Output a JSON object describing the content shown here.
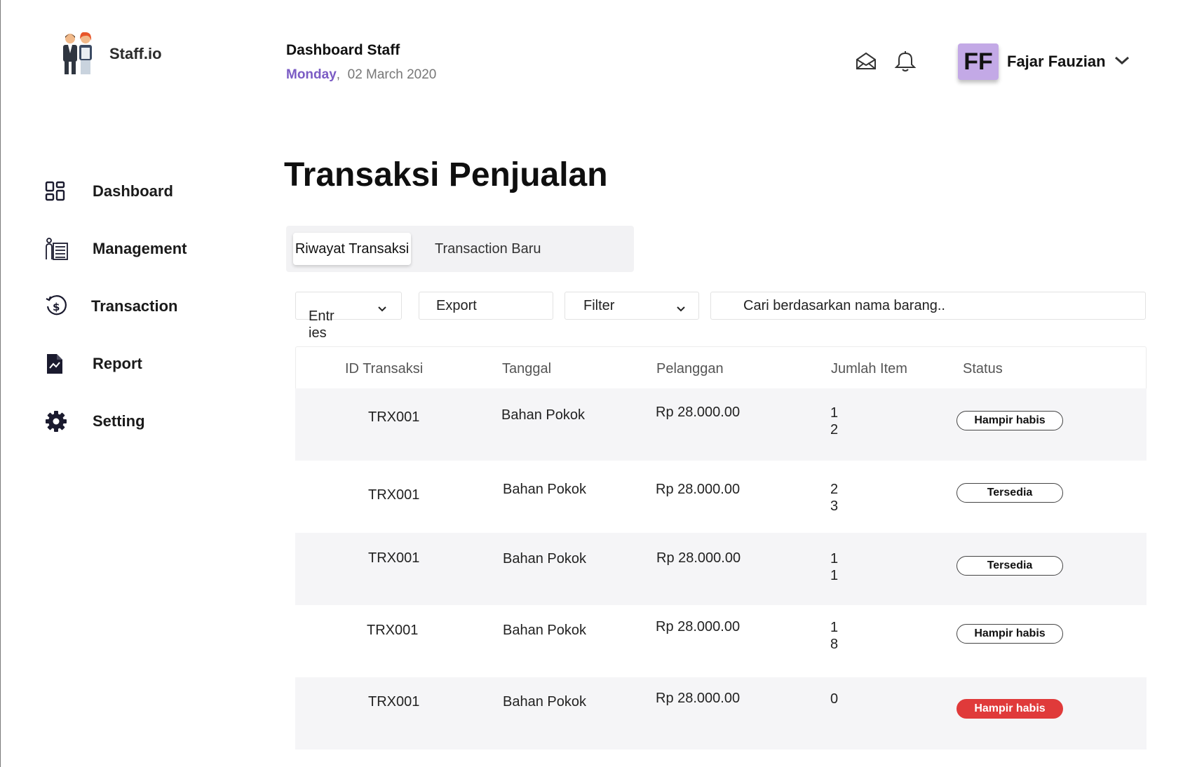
{
  "brand": {
    "name": "Staff.io",
    "logo_icon": "staff-people-logo"
  },
  "header": {
    "title": "Dashboard Staff",
    "day": "Monday",
    "date": "02 March 2020",
    "mail_icon": "mail-open-icon",
    "bell_icon": "bell-icon"
  },
  "user": {
    "initials": "FF",
    "name": "Fajar Fauzian",
    "avatar_color": "#c3a9e6"
  },
  "sidebar": {
    "items": [
      {
        "label": "Dashboard",
        "icon": "grid-icon"
      },
      {
        "label": "Management",
        "icon": "checklist-person-icon"
      },
      {
        "label": "Transaction",
        "icon": "dollar-cycle-icon"
      },
      {
        "label": "Report",
        "icon": "report-file-icon"
      },
      {
        "label": "Setting",
        "icon": "gear-icon"
      }
    ]
  },
  "page": {
    "title": "Transaksi Penjualan"
  },
  "tabs": [
    {
      "label": "Riwayat Transaksi",
      "active": true
    },
    {
      "label": "Transaction Baru",
      "active": false
    }
  ],
  "controls": {
    "entries_label": "Entr ies",
    "export_label": "Export",
    "filter_label": "Filter",
    "search_placeholder": "Cari berdasarkan nama barang.."
  },
  "table": {
    "headers": [
      "ID Transaksi",
      "Tanggal",
      "Pelanggan",
      "Jumlah Item",
      "Status"
    ],
    "rows": [
      {
        "id": "TRX001",
        "tanggal": "Bahan Pokok",
        "pelanggan": "Rp 28.000.00",
        "jumlah": "12",
        "status": "Hampir habis",
        "danger": false
      },
      {
        "id": "TRX001",
        "tanggal": "Bahan Pokok",
        "pelanggan": "Rp 28.000.00",
        "jumlah": "23",
        "status": "Tersedia",
        "danger": false
      },
      {
        "id": "TRX001",
        "tanggal": "Bahan Pokok",
        "pelanggan": "Rp 28.000.00",
        "jumlah": "11",
        "status": "Tersedia",
        "danger": false
      },
      {
        "id": "TRX001",
        "tanggal": "Bahan Pokok",
        "pelanggan": "Rp 28.000.00",
        "jumlah": "18",
        "status": "Hampir habis",
        "danger": false
      },
      {
        "id": "TRX001",
        "tanggal": "Bahan Pokok",
        "pelanggan": "Rp 28.000.00",
        "jumlah": "0",
        "status": "Hampir habis",
        "danger": true
      }
    ]
  },
  "colors": {
    "accent": "#7b5cc4",
    "danger": "#e03a3a",
    "row_shade": "#f5f5f7"
  }
}
